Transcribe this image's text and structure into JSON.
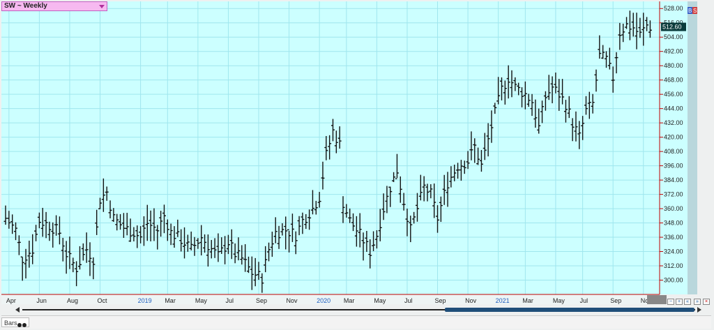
{
  "header": {
    "title": "SW ~ Weekly"
  },
  "price_box": {
    "label": "512.60"
  },
  "side_buttons": [
    "B",
    "S"
  ],
  "footer": {
    "tab_label": "Bars"
  },
  "colors": {
    "background": "#ccffff",
    "grid": "#9fe6ee",
    "bars": "#111111",
    "axis_red": "#c00000",
    "year_label": "#1f5fbf",
    "thumb": "#1f4e79"
  },
  "chart_data": {
    "type": "ohlc_bar",
    "ylim": [
      288,
      534
    ],
    "y_ticks": [
      300,
      312,
      324,
      336,
      348,
      360,
      372,
      384,
      396,
      408,
      420,
      432,
      444,
      456,
      468,
      480,
      492,
      504,
      516,
      528
    ],
    "y_tick_labels": [
      "300.00",
      "312.00",
      "324.00",
      "336.00",
      "348.00",
      "360.00",
      "372.00",
      "384.00",
      "396.00",
      "408.00",
      "420.00",
      "432.00",
      "444.00",
      "456.00",
      "468.00",
      "480.00",
      "492.00",
      "504.00",
      "516.00",
      "528.00"
    ],
    "last_price": 512.6,
    "x_labels": [
      {
        "text": "Apr",
        "week": 1,
        "year": false
      },
      {
        "text": "Jun",
        "week": 10,
        "year": false
      },
      {
        "text": "Aug",
        "week": 19,
        "year": false
      },
      {
        "text": "Oct",
        "week": 28,
        "year": false
      },
      {
        "text": "2019",
        "week": 40,
        "year": true
      },
      {
        "text": "Mar",
        "week": 48,
        "year": false
      },
      {
        "text": "May",
        "week": 57,
        "year": false
      },
      {
        "text": "Jul",
        "week": 66,
        "year": false
      },
      {
        "text": "Sep",
        "week": 75,
        "year": false
      },
      {
        "text": "Nov",
        "week": 84,
        "year": false
      },
      {
        "text": "2020",
        "week": 93,
        "year": true
      },
      {
        "text": "Mar",
        "week": 101,
        "year": false
      },
      {
        "text": "May",
        "week": 110,
        "year": false
      },
      {
        "text": "Jul",
        "week": 119,
        "year": false
      },
      {
        "text": "Sep",
        "week": 128,
        "year": false
      },
      {
        "text": "Nov",
        "week": 137,
        "year": false
      },
      {
        "text": "2021",
        "week": 146,
        "year": true
      },
      {
        "text": "Mar",
        "week": 154,
        "year": false
      },
      {
        "text": "May",
        "week": 163,
        "year": false
      },
      {
        "text": "Jul",
        "week": 171,
        "year": false
      },
      {
        "text": "Sep",
        "week": 180,
        "year": false
      },
      {
        "text": "Nov",
        "week": 189,
        "year": false
      }
    ],
    "weeks": 192,
    "anchors": [
      [
        0,
        352
      ],
      [
        3,
        342
      ],
      [
        5,
        318
      ],
      [
        8,
        326
      ],
      [
        10,
        350
      ],
      [
        13,
        346
      ],
      [
        16,
        340
      ],
      [
        18,
        322
      ],
      [
        21,
        310
      ],
      [
        24,
        326
      ],
      [
        26,
        318
      ],
      [
        28,
        368
      ],
      [
        30,
        374
      ],
      [
        32,
        352
      ],
      [
        35,
        344
      ],
      [
        38,
        340
      ],
      [
        40,
        336
      ],
      [
        42,
        348
      ],
      [
        45,
        342
      ],
      [
        47,
        354
      ],
      [
        49,
        340
      ],
      [
        52,
        334
      ],
      [
        55,
        326
      ],
      [
        58,
        336
      ],
      [
        61,
        326
      ],
      [
        63,
        320
      ],
      [
        66,
        332
      ],
      [
        68,
        322
      ],
      [
        70,
        318
      ],
      [
        73,
        306
      ],
      [
        76,
        302
      ],
      [
        78,
        326
      ],
      [
        80,
        340
      ],
      [
        83,
        342
      ],
      [
        86,
        338
      ],
      [
        88,
        350
      ],
      [
        91,
        360
      ],
      [
        93,
        370
      ],
      [
        95,
        405
      ],
      [
        97,
        425
      ],
      [
        99,
        414
      ],
      [
        100,
        365
      ],
      [
        102,
        350
      ],
      [
        105,
        338
      ],
      [
        108,
        324
      ],
      [
        110,
        338
      ],
      [
        112,
        360
      ],
      [
        114,
        378
      ],
      [
        116,
        392
      ],
      [
        118,
        366
      ],
      [
        120,
        342
      ],
      [
        122,
        360
      ],
      [
        124,
        378
      ],
      [
        126,
        372
      ],
      [
        128,
        352
      ],
      [
        131,
        382
      ],
      [
        134,
        396
      ],
      [
        137,
        400
      ],
      [
        139,
        412
      ],
      [
        141,
        396
      ],
      [
        143,
        418
      ],
      [
        145,
        440
      ],
      [
        147,
        460
      ],
      [
        149,
        470
      ],
      [
        151,
        462
      ],
      [
        154,
        456
      ],
      [
        156,
        450
      ],
      [
        158,
        428
      ],
      [
        160,
        454
      ],
      [
        162,
        462
      ],
      [
        164,
        456
      ],
      [
        166,
        448
      ],
      [
        168,
        432
      ],
      [
        170,
        420
      ],
      [
        172,
        442
      ],
      [
        174,
        448
      ],
      [
        176,
        488
      ],
      [
        178,
        485
      ],
      [
        180,
        470
      ],
      [
        182,
        508
      ],
      [
        184,
        514
      ],
      [
        186,
        512
      ],
      [
        188,
        506
      ],
      [
        190,
        514
      ],
      [
        191,
        512.6
      ]
    ]
  }
}
